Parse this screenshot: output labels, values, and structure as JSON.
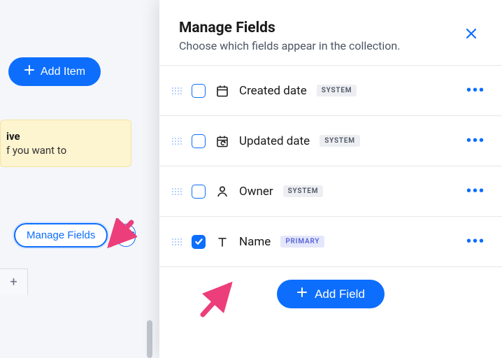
{
  "left": {
    "add_item_label": "Add Item",
    "notice_title": "ive",
    "notice_body": "f you want to",
    "manage_fields_label": "Manage Fields",
    "extra_btn_label": "S"
  },
  "panel": {
    "title": "Manage Fields",
    "subtitle": "Choose which fields appear in the collection.",
    "add_field_label": "Add Field",
    "fields": [
      {
        "name": "Created date",
        "tag": "SYSTEM",
        "tag_kind": "system",
        "icon": "calendar",
        "checked": false
      },
      {
        "name": "Updated date",
        "tag": "SYSTEM",
        "tag_kind": "system",
        "icon": "calendar-refresh",
        "checked": false
      },
      {
        "name": "Owner",
        "tag": "SYSTEM",
        "tag_kind": "system",
        "icon": "person",
        "checked": false
      },
      {
        "name": "Name",
        "tag": "PRIMARY",
        "tag_kind": "primary",
        "icon": "text",
        "checked": true
      }
    ]
  }
}
